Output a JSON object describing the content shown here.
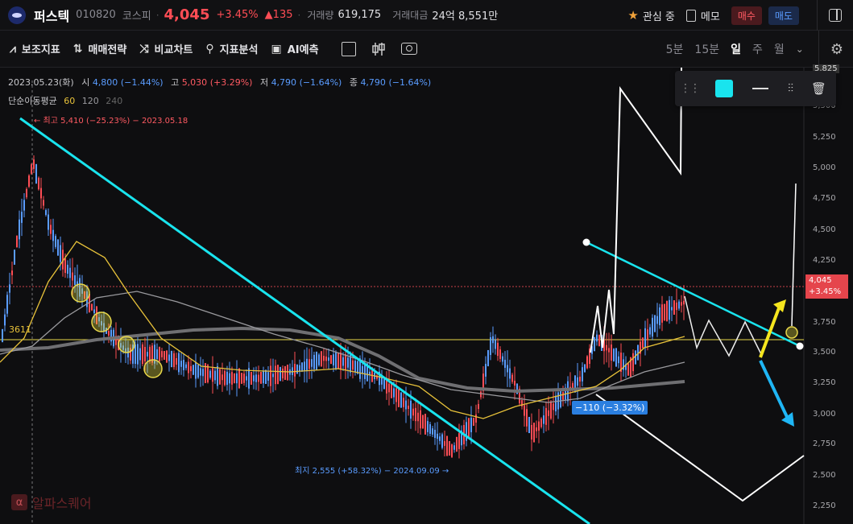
{
  "header": {
    "stock_name": "퍼스텍",
    "code": "010820",
    "market": "코스피",
    "separator": "·",
    "price": "4,045",
    "change_pct": "+3.45%",
    "change_abs": "▲135",
    "volume_label": "거래량",
    "volume_value": "619,175",
    "amount_label": "거래대금",
    "amount_value": "24억 8,551만",
    "watch_label": "관심 중",
    "memo_label": "메모",
    "buy_label": "매수",
    "sell_label": "매도"
  },
  "toolbar": {
    "items": [
      "보조지표",
      "매매전략",
      "비교차트",
      "지표분석",
      "AI예측"
    ],
    "periods": [
      "5분",
      "15분",
      "일",
      "주",
      "월"
    ],
    "active_period": "일"
  },
  "chart_info": {
    "date": "2023.05.23(화)",
    "open_label": "시",
    "open": "4,800",
    "open_pct": "(−1.44%)",
    "high_label": "고",
    "high": "5,030",
    "high_pct": "(+3.29%)",
    "low_label": "저",
    "low": "4,790",
    "low_pct": "(−1.64%)",
    "close_label": "종",
    "close": "4,790",
    "close_pct": "(−1.64%)",
    "ma_label": "단순이동평균",
    "ma60": "60",
    "ma120": "120",
    "ma240": "240"
  },
  "annotations": {
    "high_note": "← 최고 5,410 (−25.23%) − 2023.05.18",
    "low_note": "최지 2,555 (+58.32%) − 2024.09.09 →",
    "ma_value_tag": "3611",
    "marker_tag": "−110 (−3.32%)",
    "price_tag_price": "4,045",
    "price_tag_pct": "+3.45%",
    "top_axis_tag": "5,825"
  },
  "axis_labels": [
    "5,500",
    "5,250",
    "5,000",
    "4,750",
    "4,500",
    "4,250",
    "3,750",
    "3,500",
    "3,250",
    "3,000",
    "2,750",
    "2,500",
    "2,250"
  ],
  "watermark": {
    "badge": "α",
    "text": "알파스퀘어"
  },
  "colors": {
    "up": "#ff4d55",
    "down": "#5a9cff",
    "trend_line": "#19e4ee",
    "ma60": "#e8c23a",
    "accent_star": "#f2a33a"
  }
}
